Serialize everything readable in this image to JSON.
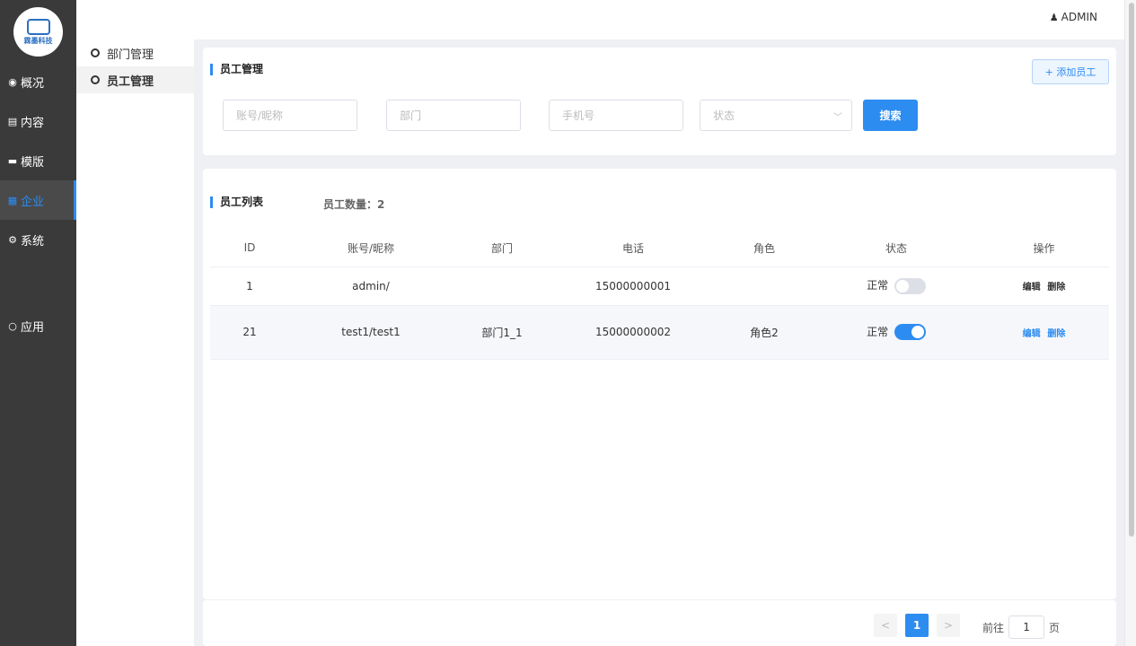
{
  "brand": {
    "logo_text": "霖墨科技"
  },
  "header": {
    "user_name": "ADMIN",
    "user_icon": "person-icon"
  },
  "sidebar": {
    "items": [
      {
        "label": "概况",
        "icon": "dashboard-icon"
      },
      {
        "label": "内容",
        "icon": "document-icon"
      },
      {
        "label": "模版",
        "icon": "template-icon"
      },
      {
        "label": "企业",
        "icon": "enterprise-icon"
      },
      {
        "label": "系统",
        "icon": "gears-icon"
      },
      {
        "label": "应用",
        "icon": "circle-icon"
      }
    ]
  },
  "submenu": {
    "items": [
      {
        "label": "部门管理"
      },
      {
        "label": "员工管理"
      }
    ]
  },
  "search": {
    "title": "员工管理",
    "add_button": "+ 添加员工",
    "account_placeholder": "账号/昵称",
    "dept_placeholder": "部门",
    "phone_placeholder": "手机号",
    "status_placeholder": "状态",
    "search_button": "搜索"
  },
  "list": {
    "title": "员工列表",
    "count_label": "员工数量：2",
    "columns": [
      "ID",
      "账号/昵称",
      "部门",
      "电话",
      "角色",
      "状态",
      "操作"
    ],
    "rows": [
      {
        "id": "1",
        "account": "admin/",
        "dept": "",
        "phone": "15000000001",
        "role": "",
        "status": "正常",
        "enabled": false,
        "edit": "编辑",
        "delete": "删除"
      },
      {
        "id": "21",
        "account": "test1/test1",
        "dept": "部门1_1",
        "phone": "15000000002",
        "role": "角色2",
        "status": "正常",
        "enabled": true,
        "edit": "编辑",
        "delete": "删除"
      }
    ]
  },
  "pagination": {
    "prev": "<",
    "current_page": "1",
    "next": ">",
    "goto_label": "前往",
    "goto_value": "1",
    "page_suffix": "页"
  },
  "colors": {
    "accent": "#2d8cf0",
    "sidebar_bg": "#3a3a3a"
  }
}
